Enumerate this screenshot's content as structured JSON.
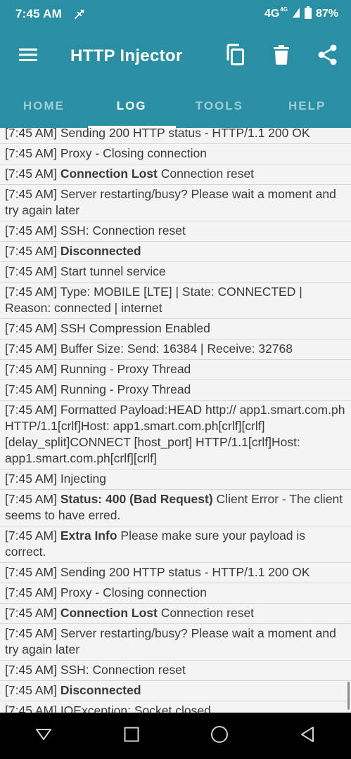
{
  "status_bar": {
    "time": "7:45 AM",
    "network": "4G",
    "network_sup": "4G",
    "battery": "87%"
  },
  "app_bar": {
    "title": "HTTP Injector",
    "icons": [
      "menu-icon",
      "copy-icon",
      "trash-icon",
      "share-icon"
    ]
  },
  "tabs": [
    {
      "label": "HOME",
      "active": false
    },
    {
      "label": "LOG",
      "active": true
    },
    {
      "label": "TOOLS",
      "active": false
    },
    {
      "label": "HELP",
      "active": false
    }
  ],
  "log": [
    {
      "time": "[7:45 AM]",
      "bold": "",
      "text": "Sending 200 HTTP status - HTTP/1.1 200 OK"
    },
    {
      "time": "[7:45 AM]",
      "bold": "",
      "text": "Proxy - Closing connection"
    },
    {
      "time": "[7:45 AM]",
      "bold": "Connection Lost",
      "text": "Connection reset"
    },
    {
      "time": "[7:45 AM]",
      "bold": "",
      "text": "Server restarting/busy? Please wait a moment and try again later"
    },
    {
      "time": "[7:45 AM]",
      "bold": "",
      "text": "SSH: Connection reset"
    },
    {
      "time": "[7:45 AM]",
      "bold": "Disconnected",
      "text": ""
    },
    {
      "time": "[7:45 AM]",
      "bold": "",
      "text": "Start tunnel service"
    },
    {
      "time": "[7:45 AM]",
      "bold": "",
      "text": "Type: MOBILE [LTE] | State: CONNECTED | Reason: connected | internet"
    },
    {
      "time": "[7:45 AM]",
      "bold": "",
      "text": "SSH Compression Enabled"
    },
    {
      "time": "[7:45 AM]",
      "bold": "",
      "text": "Buffer Size: Send: 16384 | Receive: 32768"
    },
    {
      "time": "[7:45 AM]",
      "bold": "",
      "text": "Running - Proxy Thread"
    },
    {
      "time": "[7:45 AM]",
      "bold": "",
      "text": "Running - Proxy Thread"
    },
    {
      "time": "[7:45 AM]",
      "bold": "",
      "text": "Formatted Payload:HEAD http:// app1.smart.com.ph HTTP/1.1[crlf]Host: app1.smart.com.ph[crlf][crlf][delay_split]CONNECT [host_port] HTTP/1.1[crlf]Host: app1.smart.com.ph[crlf][crlf]"
    },
    {
      "time": "[7:45 AM]",
      "bold": "",
      "text": "Injecting"
    },
    {
      "time": "[7:45 AM]",
      "bold": "Status: 400 (Bad Request)",
      "text": "Client Error - The client seems to have erred."
    },
    {
      "time": "[7:45 AM]",
      "bold": "Extra Info",
      "text": "Please make sure your payload is correct."
    },
    {
      "time": "[7:45 AM]",
      "bold": "",
      "text": "Sending 200 HTTP status - HTTP/1.1 200 OK"
    },
    {
      "time": "[7:45 AM]",
      "bold": "",
      "text": "Proxy - Closing connection"
    },
    {
      "time": "[7:45 AM]",
      "bold": "Connection Lost",
      "text": "Connection reset"
    },
    {
      "time": "[7:45 AM]",
      "bold": "",
      "text": "Server restarting/busy? Please wait a moment and try again later"
    },
    {
      "time": "[7:45 AM]",
      "bold": "",
      "text": "SSH: Connection reset"
    },
    {
      "time": "[7:45 AM]",
      "bold": "Disconnected",
      "text": ""
    },
    {
      "time": "[7:45 AM]",
      "bold": "",
      "text": "IOException: Socket closed"
    }
  ],
  "nav_bar": {
    "icons": [
      "back-icon",
      "recents-icon",
      "home-icon",
      "back-triangle-icon"
    ]
  },
  "colors": {
    "primary": "#2a8fa3",
    "log_bg": "#f4f4f4",
    "divider": "#d6d6d6",
    "text": "#3a3a3a"
  }
}
